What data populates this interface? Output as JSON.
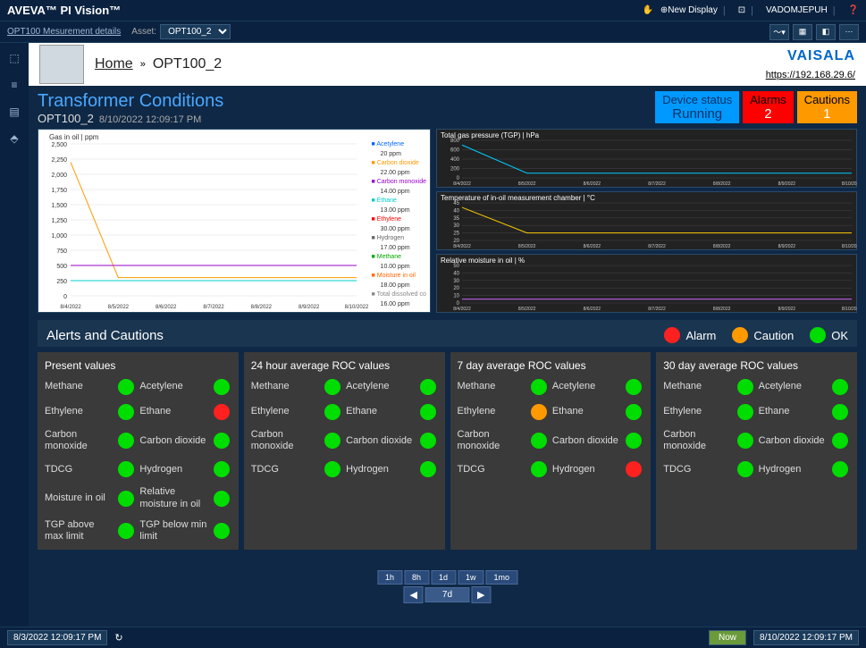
{
  "topbar": {
    "brand": "AVEVA™ PI Vision™",
    "new_display": "New Display",
    "user": "VADOMJEPUH"
  },
  "subbar": {
    "crumb": "OPT100 Mesurement details",
    "asset_label": "Asset:",
    "asset_value": "OPT100_2"
  },
  "header": {
    "home": "Home",
    "asset": "OPT100_2",
    "brand": "VAISALA",
    "url": "https://192.168.29.6/"
  },
  "title": {
    "main": "Transformer Conditions",
    "asset": "OPT100_2",
    "timestamp": "8/10/2022 12:09:17 PM"
  },
  "status": {
    "device_label": "Device status",
    "device_value": "Running",
    "alarms_label": "Alarms",
    "alarms_value": "2",
    "cautions_label": "Cautions",
    "cautions_value": "1"
  },
  "charts": {
    "main_title": "Gas in oil | ppm",
    "legend": [
      {
        "name": "Acetylene",
        "val": "20 ppm",
        "color": "#0066ff"
      },
      {
        "name": "Carbon dioxide",
        "val": "22.00 ppm",
        "color": "#ff9900"
      },
      {
        "name": "Carbon monoxide",
        "val": "14.00 ppm",
        "color": "#9900cc"
      },
      {
        "name": "Ethane",
        "val": "13.00 ppm",
        "color": "#00cccc"
      },
      {
        "name": "Ethylene",
        "val": "30.00 ppm",
        "color": "#ff0000"
      },
      {
        "name": "Hydrogen",
        "val": "17.00 ppm",
        "color": "#666"
      },
      {
        "name": "Methane",
        "val": "10.00 ppm",
        "color": "#00aa00"
      },
      {
        "name": "Moisture in oil",
        "val": "18.00 ppm",
        "color": "#ff6600"
      },
      {
        "name": "Total dissolved co",
        "val": "16.00 ppm",
        "color": "#888"
      }
    ],
    "mini": [
      {
        "title": "Total gas pressure (TGP) | hPa"
      },
      {
        "title": "Temperature of in-oil measurement chamber | °C"
      },
      {
        "title": "Relative moisture in oil | %"
      }
    ]
  },
  "chart_data": {
    "type": "line",
    "x": [
      "8/4/2022",
      "8/5/2022",
      "8/6/2022",
      "8/7/2022",
      "8/8/2022",
      "8/9/2022",
      "8/10/2022"
    ],
    "ylim": [
      0,
      2500
    ],
    "yticks": [
      0,
      250,
      500,
      750,
      1000,
      1250,
      1500,
      1750,
      2000,
      2250,
      2500
    ],
    "title": "Gas in oil | ppm",
    "series": [
      {
        "name": "Carbon dioxide",
        "color": "#ff9900",
        "values": [
          2200,
          300,
          300,
          300,
          300,
          300,
          300
        ]
      },
      {
        "name": "Ethylene",
        "color": "#ff0000",
        "values": [
          250,
          250,
          250,
          250,
          250,
          250,
          250
        ]
      },
      {
        "name": "Ethane",
        "color": "#00cccc",
        "values": [
          250,
          250,
          250,
          250,
          250,
          250,
          250
        ]
      },
      {
        "name": "Carbon monoxide",
        "color": "#9900cc",
        "values": [
          500,
          500,
          500,
          500,
          500,
          500,
          500
        ]
      }
    ],
    "mini": [
      {
        "title": "Total gas pressure (TGP) | hPa",
        "ylim": [
          0,
          800
        ],
        "yticks": [
          0,
          200,
          400,
          600,
          800
        ],
        "x": [
          "8/4/2022",
          "8/5/2022",
          "8/6/2022",
          "8/7/2022",
          "8/8/2022",
          "8/9/2022",
          "8/10/2022"
        ],
        "values": [
          700,
          100,
          100,
          100,
          100,
          100,
          100
        ],
        "color": "#00ccff"
      },
      {
        "title": "Temperature of in-oil measurement chamber | °C",
        "ylim": [
          20,
          45
        ],
        "yticks": [
          20,
          25,
          30,
          35,
          40,
          45
        ],
        "x": [
          "8/4/2022",
          "8/5/2022",
          "8/6/2022",
          "8/7/2022",
          "8/8/2022",
          "8/9/2022",
          "8/10/2022"
        ],
        "values": [
          42,
          25,
          25,
          25,
          25,
          25,
          25
        ],
        "color": "#ffcc00"
      },
      {
        "title": "Relative moisture in oil | %",
        "ylim": [
          0,
          50
        ],
        "yticks": [
          0,
          10,
          20,
          30,
          40,
          50
        ],
        "x": [
          "8/4/2022",
          "8/5/2022",
          "8/6/2022",
          "8/7/2022",
          "8/8/2022",
          "8/9/2022",
          "8/10/2022"
        ],
        "values": [
          5,
          5,
          5,
          5,
          5,
          5,
          5
        ],
        "color": "#cc66ff"
      }
    ]
  },
  "alerts": {
    "title": "Alerts and Cautions",
    "legend_alarm": "Alarm",
    "legend_caution": "Caution",
    "legend_ok": "OK"
  },
  "panels": [
    {
      "title": "Present values",
      "rows": [
        [
          "Methane",
          "green",
          "Acetylene",
          "green"
        ],
        [
          "Ethylene",
          "green",
          "Ethane",
          "red"
        ],
        [
          "Carbon monoxide",
          "green",
          "Carbon dioxide",
          "green"
        ],
        [
          "TDCG",
          "green",
          "Hydrogen",
          "green"
        ],
        [
          "Moisture in oil",
          "green",
          "Relative moisture in oil",
          "green"
        ],
        [
          "TGP above max limit",
          "green",
          "TGP below min limit",
          "green"
        ]
      ]
    },
    {
      "title": "24 hour average ROC values",
      "rows": [
        [
          "Methane",
          "green",
          "Acetylene",
          "green"
        ],
        [
          "Ethylene",
          "green",
          "Ethane",
          "green"
        ],
        [
          "Carbon monoxide",
          "green",
          "Carbon dioxide",
          "green"
        ],
        [
          "TDCG",
          "green",
          "Hydrogen",
          "green"
        ]
      ]
    },
    {
      "title": "7 day average ROC values",
      "rows": [
        [
          "Methane",
          "green",
          "Acetylene",
          "green"
        ],
        [
          "Ethylene",
          "orange",
          "Ethane",
          "green"
        ],
        [
          "Carbon monoxide",
          "green",
          "Carbon dioxide",
          "green"
        ],
        [
          "TDCG",
          "green",
          "Hydrogen",
          "red"
        ]
      ]
    },
    {
      "title": "30 day average ROC values",
      "rows": [
        [
          "Methane",
          "green",
          "Acetylene",
          "green"
        ],
        [
          "Ethylene",
          "green",
          "Ethane",
          "green"
        ],
        [
          "Carbon monoxide",
          "green",
          "Carbon dioxide",
          "green"
        ],
        [
          "TDCG",
          "green",
          "Hydrogen",
          "green"
        ]
      ]
    }
  ],
  "timenav": {
    "buttons": [
      "1h",
      "8h",
      "1d",
      "1w",
      "1mo"
    ],
    "current": "7d"
  },
  "footer": {
    "start": "8/3/2022 12:09:17 PM",
    "now": "Now",
    "end": "8/10/2022 12:09:17 PM"
  }
}
